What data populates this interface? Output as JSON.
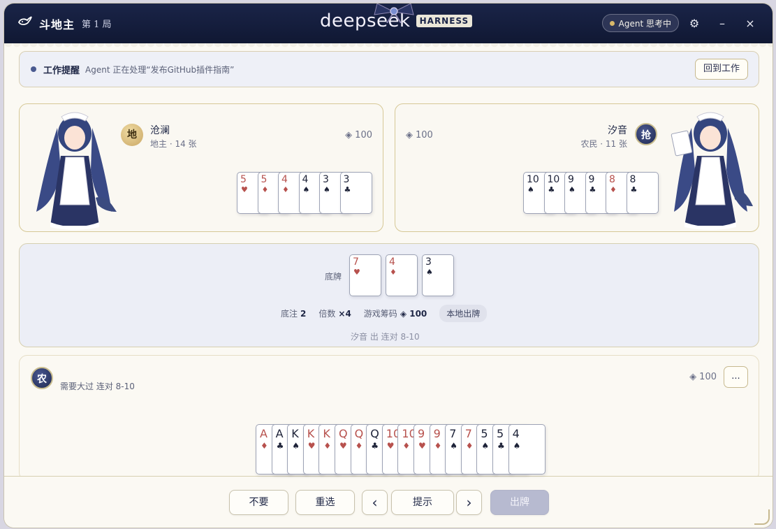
{
  "titlebar": {
    "game_title": "斗地主",
    "round": "第 1 局",
    "brand_name": "deepseek",
    "brand_tag": "HARNESS",
    "agent_status": "Agent 思考中",
    "settings_icon": "gear-icon",
    "minimize": "–",
    "close": "×"
  },
  "notice": {
    "title": "工作提醒",
    "text": "Agent 正在处理“发布GitHub插件指南”",
    "button": "回到工作"
  },
  "players": {
    "left": {
      "badge": "地",
      "name": "沧澜",
      "role": "地主 · 14 张",
      "chips": "100",
      "cards": [
        {
          "rank": "5",
          "suit": "♥",
          "color": "red"
        },
        {
          "rank": "5",
          "suit": "♦",
          "color": "red"
        },
        {
          "rank": "4",
          "suit": "♦",
          "color": "red"
        },
        {
          "rank": "4",
          "suit": "♠",
          "color": "black"
        },
        {
          "rank": "3",
          "suit": "♠",
          "color": "black"
        },
        {
          "rank": "3",
          "suit": "♣",
          "color": "black"
        }
      ]
    },
    "right": {
      "badge": "抢",
      "name": "汐音",
      "role": "农民 · 11 张",
      "chips": "100",
      "cards": [
        {
          "rank": "10",
          "suit": "♠",
          "color": "black"
        },
        {
          "rank": "10",
          "suit": "♣",
          "color": "black"
        },
        {
          "rank": "9",
          "suit": "♠",
          "color": "black"
        },
        {
          "rank": "9",
          "suit": "♣",
          "color": "black"
        },
        {
          "rank": "8",
          "suit": "♦",
          "color": "red"
        },
        {
          "rank": "8",
          "suit": "♣",
          "color": "black"
        }
      ]
    }
  },
  "table": {
    "bottom_label": "底牌",
    "bottom_cards": [
      {
        "rank": "7",
        "suit": "♥",
        "color": "red"
      },
      {
        "rank": "4",
        "suit": "♦",
        "color": "red"
      },
      {
        "rank": "3",
        "suit": "♠",
        "color": "black"
      }
    ],
    "base_label": "底注",
    "base_value": "2",
    "multiplier_label": "倍数",
    "multiplier_value": "×4",
    "chips_label": "游戏筹码",
    "chips_value": "100",
    "local_play": "本地出牌",
    "history": "汐音 出 连对 8-10"
  },
  "self": {
    "badge": "农",
    "need": "需要大过 连对 8-10",
    "chips": "100",
    "more": "...",
    "cards": [
      {
        "rank": "A",
        "suit": "♦",
        "color": "red"
      },
      {
        "rank": "A",
        "suit": "♣",
        "color": "black"
      },
      {
        "rank": "K",
        "suit": "♠",
        "color": "black"
      },
      {
        "rank": "K",
        "suit": "♥",
        "color": "red"
      },
      {
        "rank": "K",
        "suit": "♦",
        "color": "red"
      },
      {
        "rank": "Q",
        "suit": "♥",
        "color": "red"
      },
      {
        "rank": "Q",
        "suit": "♦",
        "color": "red"
      },
      {
        "rank": "Q",
        "suit": "♣",
        "color": "black"
      },
      {
        "rank": "10",
        "suit": "♥",
        "color": "red"
      },
      {
        "rank": "10",
        "suit": "♦",
        "color": "red"
      },
      {
        "rank": "9",
        "suit": "♥",
        "color": "red"
      },
      {
        "rank": "9",
        "suit": "♦",
        "color": "red"
      },
      {
        "rank": "7",
        "suit": "♠",
        "color": "black"
      },
      {
        "rank": "7",
        "suit": "♦",
        "color": "red"
      },
      {
        "rank": "5",
        "suit": "♠",
        "color": "black"
      },
      {
        "rank": "5",
        "suit": "♣",
        "color": "black"
      },
      {
        "rank": "4",
        "suit": "♠",
        "color": "black"
      }
    ]
  },
  "actions": {
    "pass": "不要",
    "reset": "重选",
    "prev": "‹",
    "hint": "提示",
    "next": "›",
    "play": "出牌"
  },
  "colors": {
    "navy": "#1a2448",
    "gold": "#c9a663",
    "card_red": "#b7514d",
    "card_black": "#1d2238"
  }
}
